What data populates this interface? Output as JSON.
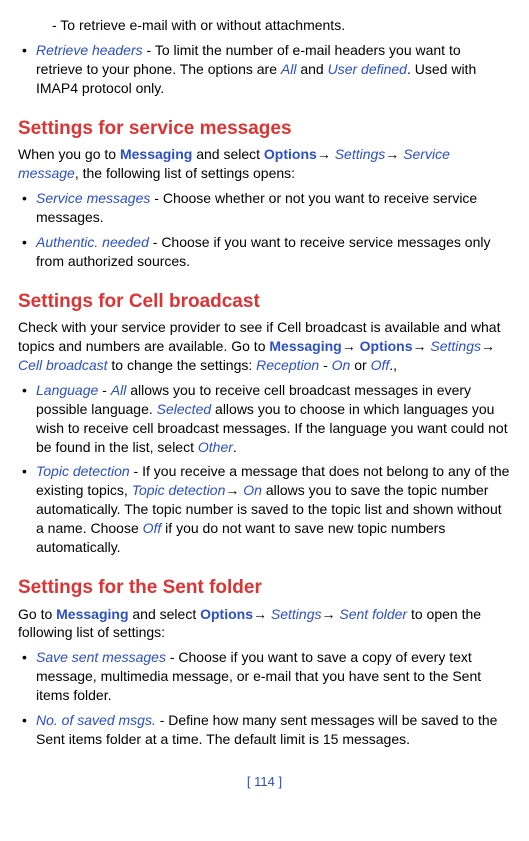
{
  "intro_continued_line": "- To retrieve e-mail with or without attachments.",
  "retrieve_headers": {
    "label": "Retrieve headers",
    "text_1": " - To limit the number of e-mail headers you want to retrieve to your phone. The options are ",
    "opt_all": "All",
    "text_2": " and ",
    "opt_user": "User defined",
    "text_3": ".  Used with IMAP4 protocol only."
  },
  "svc_heading": "Settings for service messages",
  "svc_intro": {
    "t1": "When you go to ",
    "messaging": "Messaging",
    "t2": " and select ",
    "options": "Options",
    "arrow1": "→ ",
    "settings": "Settings",
    "arrow2": "→ ",
    "service_message": "Service message",
    "t3": ", the following list of settings opens:"
  },
  "svc_item1": {
    "label": "Service messages",
    "text": " - Choose whether or not you want to receive service messages."
  },
  "svc_item2": {
    "label": "Authentic. needed",
    "text": " - Choose if you want to receive service messages only from authorized sources."
  },
  "cb_heading": "Settings for Cell broadcast",
  "cb_intro": {
    "t1": "Check with your service provider to see if Cell broadcast is available and what topics and numbers are available. Go to ",
    "messaging": "Messaging",
    "arrow1": "→ ",
    "options": "Options",
    "arrow2": "→ ",
    "settings": "Settings",
    "arrow3": "→ ",
    "cell_broadcast": "Cell broadcast",
    "t2": " to change the settings: ",
    "reception": "Reception",
    "t3": " - ",
    "on": "On",
    "t4": " or ",
    "off": "Off",
    "t5": ".,"
  },
  "cb_item1": {
    "label": "Language",
    "t1": " - ",
    "all": "All",
    "t2": " allows you to receive cell broadcast messages in every possible language. ",
    "selected": "Selected",
    "t3": " allows you to choose in which languages you wish to receive cell broadcast messages. If the language you want could not be found in the list, select ",
    "other": "Other",
    "t4": "."
  },
  "cb_item2": {
    "label": "Topic detection",
    "t1": " - If you receive a message that does not belong to any of the existing topics, ",
    "topic_det2": "Topic detection",
    "arrow1": "→ ",
    "on": "On",
    "t2": " allows you to save the topic number automatically. The topic number is saved to the topic list and shown without a name. Choose ",
    "off": "Off",
    "t3": " if you do not want to save new topic numbers automatically."
  },
  "sent_heading": "Settings for the Sent folder",
  "sent_intro": {
    "t1": "Go to ",
    "messaging": "Messaging",
    "t2": " and select ",
    "options": "Options",
    "arrow1": "→ ",
    "settings": "Settings",
    "arrow2": "→ ",
    "sent_folder": "Sent folder",
    "t3": " to open the following list of settings:"
  },
  "sent_item1": {
    "label": "Save sent messages",
    "text": " - Choose if you want to save a copy of every text message, multimedia message, or e-mail that you have sent to the Sent items folder."
  },
  "sent_item2": {
    "label": "No. of saved msgs.",
    "text": " - Define how many sent messages will be saved to the Sent items folder at a time. The default limit is 15 messages."
  },
  "page_num": "[ 114 ]"
}
